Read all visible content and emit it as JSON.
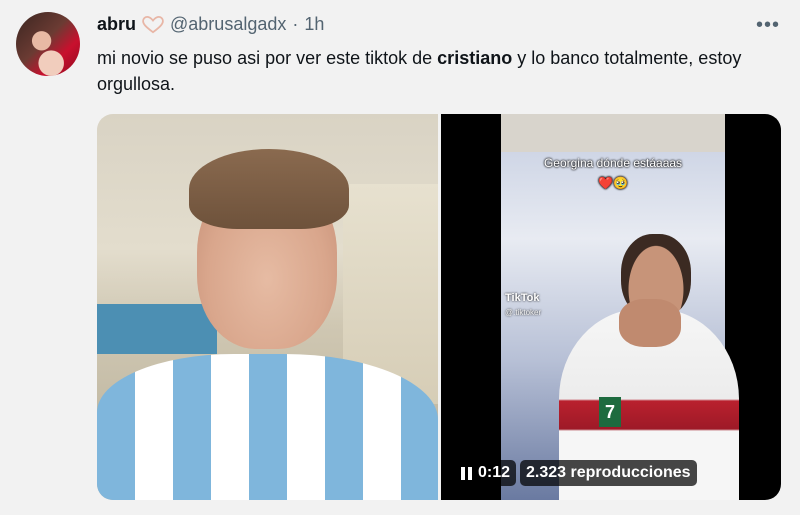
{
  "tweet": {
    "author_name": "abru",
    "author_handle": "@abrusalgadx",
    "separator": "·",
    "time": "1h",
    "text_part1": "mi novio se puso asi por ver este tiktok de ",
    "text_bold": "cristiano",
    "text_part2": " y lo banco totalmente, estoy orgullosa."
  },
  "icons": {
    "more": "more-options-icon",
    "badge": "heart-icon",
    "pause": "pause-icon"
  },
  "video": {
    "overlay_caption": "Georgina dónde estáaaas",
    "overlay_emoji": "❤️🥹",
    "watermark": "TikTok",
    "watermark_user": "@.tiktoker",
    "shirt_number": "7",
    "elapsed": "0:12",
    "views": "2.323 reproducciones"
  },
  "colors": {
    "text": "#0f1419",
    "secondary": "#536471",
    "background": "#f2f2f2"
  }
}
